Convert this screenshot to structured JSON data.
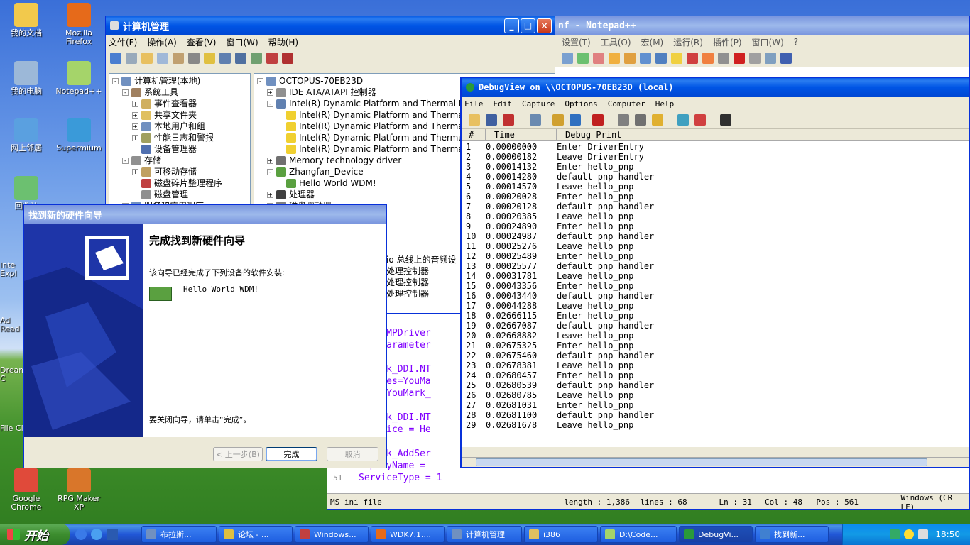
{
  "desktop_icons": [
    {
      "label": "我的文档",
      "color": "#f2c94c"
    },
    {
      "label": "Mozilla Firefox",
      "color": "#e66a1a"
    },
    {
      "label": "我的电脑",
      "color": "#9cb8d8"
    },
    {
      "label": "Notepad++",
      "color": "#a5d46a"
    },
    {
      "label": "网上邻居",
      "color": "#5aa0e0"
    },
    {
      "label": "Supermium",
      "color": "#3a9ad9"
    },
    {
      "label": "回收站",
      "color": "#6cc070"
    },
    {
      "label": "Google Chrome",
      "color": "#e04a3a"
    },
    {
      "label": "RPG Maker XP",
      "color": "#d9762a"
    }
  ],
  "desktop_partial": [
    "Inte Expl",
    "Ad Read",
    "Dream C",
    "File Cl"
  ],
  "notepad": {
    "title": "nf - Notepad++",
    "menu": [
      "设置(T)",
      "工具(O)",
      "宏(M)",
      "运行(R)",
      "插件(P)",
      "窗口(W)",
      "?"
    ],
    "code_lines": [
      {
        "num": "",
        "text": "R,,NTMPDriver"
      },
      {
        "num": "",
        "text": "R, \"Parameter"
      },
      {
        "num": "",
        "text": ""
      },
      {
        "num": "",
        "text": "ouMark_DDI.NT"
      },
      {
        "num": "",
        "text": "pyFiles=YouMa"
      },
      {
        "num": "",
        "text": "dReg=YouMark_"
      },
      {
        "num": "",
        "text": ""
      },
      {
        "num": "",
        "text": "ouMark_DDI.NT"
      },
      {
        "num": "",
        "text": "dservice = He"
      },
      {
        "num": "",
        "text": ""
      },
      {
        "num": "",
        "text": "ouMark_AddSer"
      },
      {
        "num": "",
        "text": "isplayName = "
      },
      {
        "num": "51",
        "text": "ServiceType = 1"
      }
    ],
    "status": {
      "type": "MS ini file",
      "length": "length : 1,386",
      "lines": "lines : 68",
      "ln": "Ln : 31",
      "col": "Col : 48",
      "pos": "Pos : 561",
      "eol": "Windows (CR LF)"
    }
  },
  "compmgmt": {
    "title": "计算机管理",
    "menu": [
      "文件(F)",
      "操作(A)",
      "查看(V)",
      "窗口(W)",
      "帮助(H)"
    ],
    "tree": [
      {
        "label": "计算机管理(本地)",
        "indent": 0,
        "exp": "-"
      },
      {
        "label": "系统工具",
        "indent": 1,
        "exp": "-"
      },
      {
        "label": "事件查看器",
        "indent": 2,
        "exp": "+"
      },
      {
        "label": "共享文件夹",
        "indent": 2,
        "exp": "+"
      },
      {
        "label": "本地用户和组",
        "indent": 2,
        "exp": "+"
      },
      {
        "label": "性能日志和警报",
        "indent": 2,
        "exp": "+"
      },
      {
        "label": "设备管理器",
        "indent": 2,
        "exp": ""
      },
      {
        "label": "存储",
        "indent": 1,
        "exp": "-"
      },
      {
        "label": "可移动存储",
        "indent": 2,
        "exp": "+"
      },
      {
        "label": "磁盘碎片整理程序",
        "indent": 2,
        "exp": ""
      },
      {
        "label": "磁盘管理",
        "indent": 2,
        "exp": ""
      },
      {
        "label": "服务和应用程序",
        "indent": 1,
        "exp": "+"
      }
    ],
    "devices": [
      {
        "label": "OCTOPUS-70EB23D",
        "indent": 0,
        "exp": "-"
      },
      {
        "label": "IDE ATA/ATAPI 控制器",
        "indent": 1,
        "exp": "+"
      },
      {
        "label": "Intel(R) Dynamic Platform and Thermal F",
        "indent": 1,
        "exp": "-"
      },
      {
        "label": "Intel(R) Dynamic Platform and Therma",
        "indent": 2,
        "exp": ""
      },
      {
        "label": "Intel(R) Dynamic Platform and Therma",
        "indent": 2,
        "exp": ""
      },
      {
        "label": "Intel(R) Dynamic Platform and Therma",
        "indent": 2,
        "exp": ""
      },
      {
        "label": "Intel(R) Dynamic Platform and Therma",
        "indent": 2,
        "exp": ""
      },
      {
        "label": "Memory technology driver",
        "indent": 1,
        "exp": "+"
      },
      {
        "label": "Zhangfan_Device",
        "indent": 1,
        "exp": "-"
      },
      {
        "label": "Hello World WDM!",
        "indent": 2,
        "exp": ""
      },
      {
        "label": "处理器",
        "indent": 1,
        "exp": "+"
      },
      {
        "label": "磁盘驱动器",
        "indent": 1,
        "exp": "+"
      }
    ],
    "devices_partial": [
      "io 总线上的音频设",
      "处理控制器",
      "处理控制器",
      "处理控制器"
    ]
  },
  "wizard": {
    "title": "找到新的硬件向导",
    "heading": "完成找到新硬件向导",
    "line1": "该向导已经完成了下列设备的软件安装:",
    "device": "Hello World WDM!",
    "close_hint": "要关闭向导，请单击“完成”。",
    "back": "< 上一步(B)",
    "finish": "完成",
    "cancel": "取消"
  },
  "debugview": {
    "title": "DebugView on \\\\OCTOPUS-70EB23D (local)",
    "menu": [
      "File",
      "Edit",
      "Capture",
      "Options",
      "Computer",
      "Help"
    ],
    "columns": [
      "#",
      "Time",
      "Debug Print"
    ],
    "rows": [
      [
        "1",
        "0.00000000",
        "Enter DriverEntry"
      ],
      [
        "2",
        "0.00000182",
        "Leave DriverEntry"
      ],
      [
        "3",
        "0.00014132",
        "Enter hello_pnp"
      ],
      [
        "4",
        "0.00014280",
        "default pnp handler"
      ],
      [
        "5",
        "0.00014570",
        "Leave hello_pnp"
      ],
      [
        "6",
        "0.00020028",
        "Enter hello_pnp"
      ],
      [
        "7",
        "0.00020128",
        "default pnp handler"
      ],
      [
        "8",
        "0.00020385",
        "Leave hello_pnp"
      ],
      [
        "9",
        "0.00024890",
        "Enter hello_pnp"
      ],
      [
        "10",
        "0.00024987",
        "default pnp handler"
      ],
      [
        "11",
        "0.00025276",
        "Leave hello_pnp"
      ],
      [
        "12",
        "0.00025489",
        "Enter hello_pnp"
      ],
      [
        "13",
        "0.00025577",
        "default pnp handler"
      ],
      [
        "14",
        "0.00031781",
        "Leave hello_pnp"
      ],
      [
        "15",
        "0.00043356",
        "Enter hello_pnp"
      ],
      [
        "16",
        "0.00043440",
        "default pnp handler"
      ],
      [
        "17",
        "0.00044288",
        "Leave hello_pnp"
      ],
      [
        "18",
        "0.02666115",
        "Enter hello_pnp"
      ],
      [
        "19",
        "0.02667087",
        "default pnp handler"
      ],
      [
        "20",
        "0.02668882",
        "Leave hello_pnp"
      ],
      [
        "21",
        "0.02675325",
        "Enter hello_pnp"
      ],
      [
        "22",
        "0.02675460",
        "default pnp handler"
      ],
      [
        "23",
        "0.02678381",
        "Leave hello_pnp"
      ],
      [
        "24",
        "0.02680457",
        "Enter hello_pnp"
      ],
      [
        "25",
        "0.02680539",
        "default pnp handler"
      ],
      [
        "26",
        "0.02680785",
        "Leave hello_pnp"
      ],
      [
        "27",
        "0.02681031",
        "Enter hello_pnp"
      ],
      [
        "28",
        "0.02681100",
        "default pnp handler"
      ],
      [
        "29",
        "0.02681678",
        "Leave hello_pnp"
      ]
    ]
  },
  "taskbar": {
    "start": "开始",
    "tasks": [
      "布拉斯...",
      "论坛 - ...",
      "Windows...",
      "WDK7.1....",
      "计算机管理",
      "i386",
      "D:\\Code...",
      "DebugVi...",
      "找到新..."
    ],
    "clock": "18:50"
  }
}
